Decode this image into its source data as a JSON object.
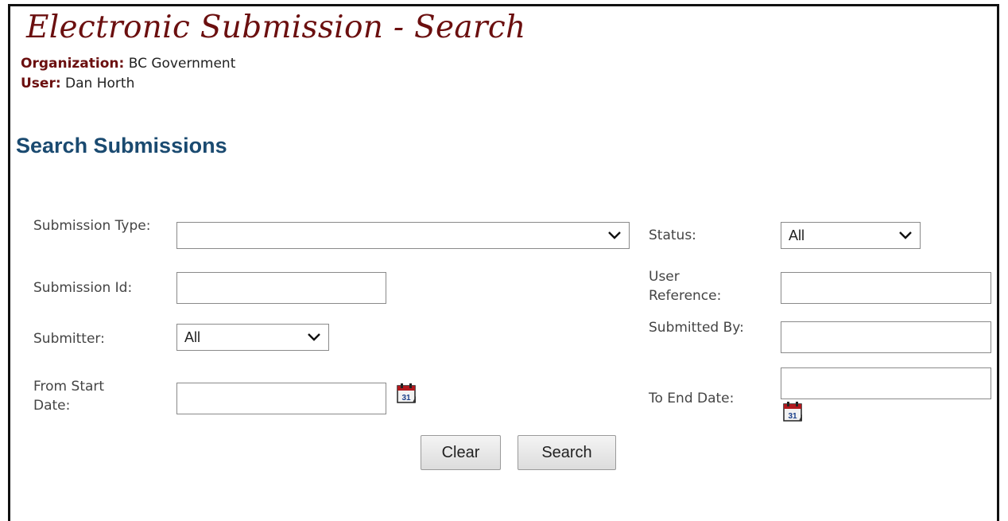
{
  "header": {
    "title": "Electronic Submission - Search",
    "organization_label": "Organization:",
    "organization_value": " BC Government",
    "user_label": "User:",
    "user_value": " Dan Horth"
  },
  "section": {
    "title": "Search Submissions"
  },
  "form": {
    "submission_type": {
      "label": "Submission Type:",
      "value": ""
    },
    "status": {
      "label": "Status:",
      "value": "All"
    },
    "submission_id": {
      "label": "Submission Id:",
      "value": ""
    },
    "user_reference": {
      "label": "User Reference:",
      "value": ""
    },
    "submitter": {
      "label": "Submitter:",
      "value": "All"
    },
    "submitted_by": {
      "label": "Submitted By:",
      "value": ""
    },
    "from_start_date": {
      "label": "From Start Date:",
      "value": ""
    },
    "to_end_date": {
      "label": "To End Date:",
      "value": ""
    }
  },
  "buttons": {
    "clear": "Clear",
    "search": "Search"
  },
  "icons": {
    "calendar": "calendar-icon",
    "dropdown": "chevron-down-icon"
  }
}
